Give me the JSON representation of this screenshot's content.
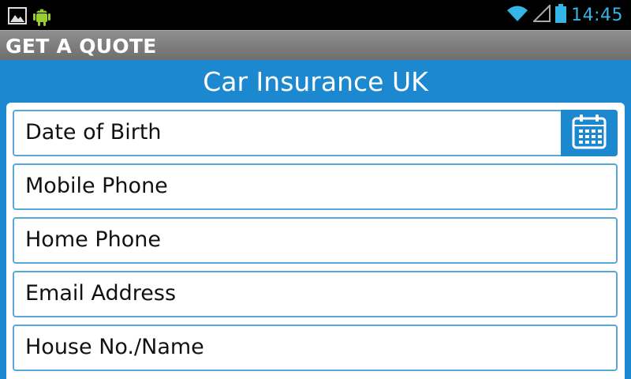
{
  "status_bar": {
    "time": "14:45",
    "left_icons": [
      "image-icon",
      "android-icon"
    ],
    "right_icons": [
      "wifi-icon",
      "signal-icon",
      "battery-icon"
    ],
    "time_color": "#33b5e5"
  },
  "action_bar": {
    "title": "GET A QUOTE"
  },
  "page": {
    "title": "Car Insurance UK"
  },
  "form": {
    "fields": [
      {
        "label": "Date of Birth",
        "icon": "calendar-icon"
      },
      {
        "label": "Mobile Phone"
      },
      {
        "label": "Home Phone"
      },
      {
        "label": "Email Address"
      },
      {
        "label": "House No./Name"
      }
    ]
  },
  "colors": {
    "accent": "#1c88d0",
    "field_border": "#58a8d8",
    "action_bar": "#808080"
  }
}
